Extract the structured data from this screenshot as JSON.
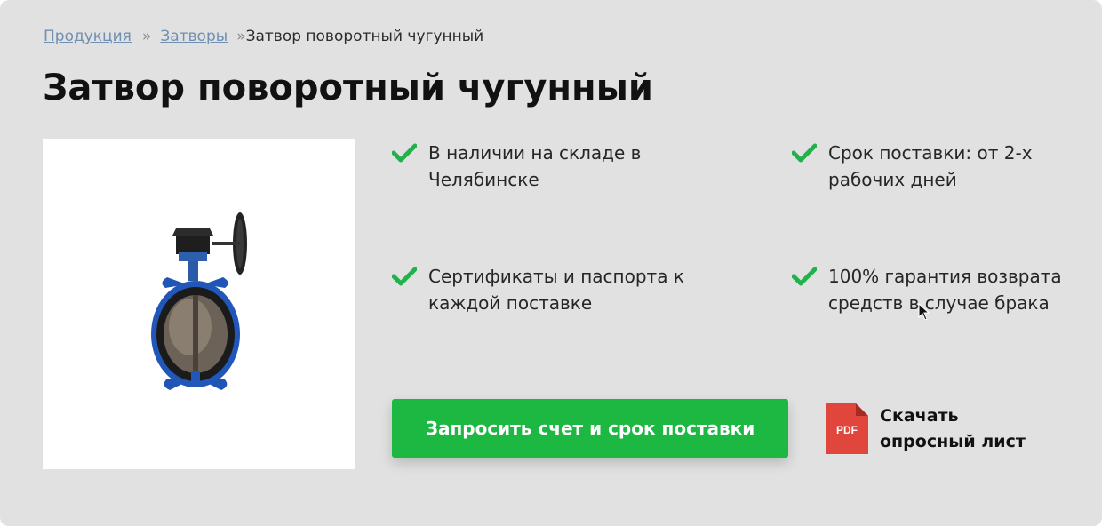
{
  "breadcrumb": {
    "items": [
      {
        "label": "Продукция"
      },
      {
        "label": "Затворы"
      }
    ],
    "separator": "»",
    "current": "Затвор поворотный чугунный"
  },
  "page": {
    "title": "Затвор поворотный чугунный"
  },
  "features": [
    {
      "text": "В наличии на складе в Челябинске"
    },
    {
      "text": "Срок поставки: от 2-х рабочих дней"
    },
    {
      "text": "Сертификаты и паспорта к каждой поставке"
    },
    {
      "text": "100% гарантия возврата средств в случае брака"
    }
  ],
  "cta": {
    "label": "Запросить счет и срок поставки"
  },
  "download": {
    "icon_text": "PDF",
    "label": "Скачать опросный лист"
  },
  "colors": {
    "background": "#e1e1e1",
    "accent_green": "#1db841",
    "check_green": "#22b24c",
    "link": "#6f8fb3",
    "pdf_red": "#e0463c"
  }
}
